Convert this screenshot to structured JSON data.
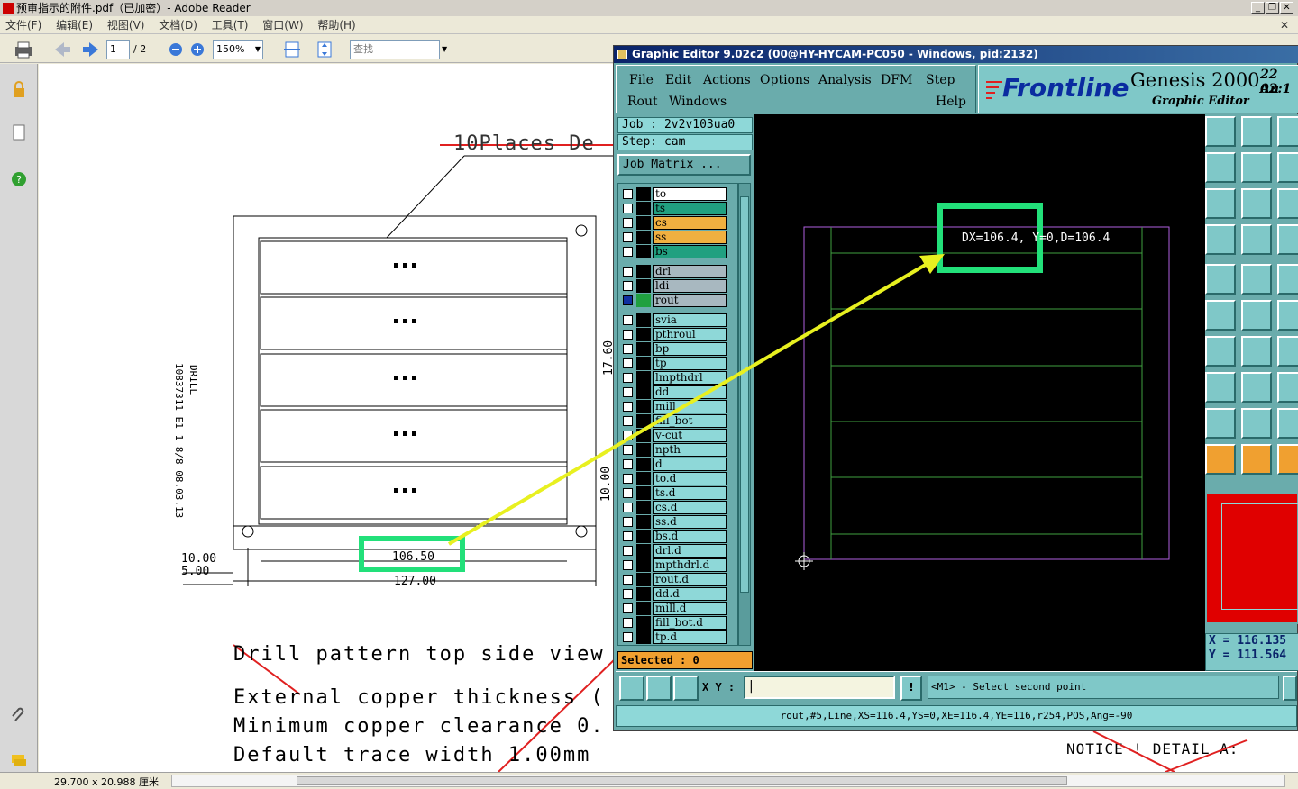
{
  "reader": {
    "title": "预审指示的附件.pdf（已加密）- Adobe Reader",
    "menu": [
      "文件(F)",
      "编辑(E)",
      "视图(V)",
      "文档(D)",
      "工具(T)",
      "窗口(W)",
      "帮助(H)"
    ],
    "page_current": "1",
    "page_total": "/ 2",
    "zoom": "150%",
    "find_placeholder": "查找",
    "status_size": "29.700 x 20.988 厘米"
  },
  "pdf": {
    "strike_title": "10Places De",
    "side_text": "10837311 E1 1    8/8 08.03.13",
    "side_text2": "DRILL",
    "dim_106": "106.50",
    "dim_127": "127.00",
    "dim_10": "10.00",
    "dim_5": "5.00",
    "dim_1760": "17.60",
    "dim_1000v": "10.00",
    "lines": [
      "Drill pattern top side view",
      "External copper thickness (",
      "Minimum copper clearance 0.",
      "Default trace width 1.00mm"
    ],
    "notice": "NOTICE ! DETAIL A:"
  },
  "genesis": {
    "title": "Graphic Editor 9.02c2 (00@HY-HYCAM-PC050 - Windows, pid:2132)",
    "menu_row1": [
      "File",
      "Edit",
      "Actions",
      "Options",
      "Analysis",
      "DFM",
      "Step"
    ],
    "menu_row2": [
      "Rout",
      "Windows",
      "Help"
    ],
    "logo": "Frontline",
    "product": "Genesis 2000",
    "subtitle": "Graphic Editor",
    "date1": "22 Au",
    "date2": "02:1",
    "job": "Job  : 2v2v103ua0",
    "step": "Step: cam",
    "job_matrix": "Job Matrix ...",
    "layers": [
      {
        "name": "to",
        "color": "#ffffff"
      },
      {
        "name": "ts",
        "color": "#20a080"
      },
      {
        "name": "cs",
        "color": "#f0b040"
      },
      {
        "name": "ss",
        "color": "#f0b040"
      },
      {
        "name": "bs",
        "color": "#20a080"
      },
      {
        "name": "drl",
        "color": "#a8b8c0"
      },
      {
        "name": "ldi",
        "color": "#a8b8c0"
      },
      {
        "name": "rout",
        "color": "#a8b8c0"
      },
      {
        "name": "svia",
        "color": "#8ed8d8"
      },
      {
        "name": "pthroul",
        "color": "#8ed8d8"
      },
      {
        "name": "bp",
        "color": "#8ed8d8"
      },
      {
        "name": "tp",
        "color": "#8ed8d8"
      },
      {
        "name": "lmpthdrl",
        "color": "#8ed8d8"
      },
      {
        "name": "dd",
        "color": "#8ed8d8"
      },
      {
        "name": "mill",
        "color": "#8ed8d8"
      },
      {
        "name": "fill_bot",
        "color": "#8ed8d8"
      },
      {
        "name": "v-cut",
        "color": "#8ed8d8"
      },
      {
        "name": "npth",
        "color": "#8ed8d8"
      },
      {
        "name": "d",
        "color": "#8ed8d8"
      },
      {
        "name": "to.d",
        "color": "#8ed8d8"
      },
      {
        "name": "ts.d",
        "color": "#8ed8d8"
      },
      {
        "name": "cs.d",
        "color": "#8ed8d8"
      },
      {
        "name": "ss.d",
        "color": "#8ed8d8"
      },
      {
        "name": "bs.d",
        "color": "#8ed8d8"
      },
      {
        "name": "drl.d",
        "color": "#8ed8d8"
      },
      {
        "name": "mpthdrl.d",
        "color": "#8ed8d8"
      },
      {
        "name": "rout.d",
        "color": "#8ed8d8"
      },
      {
        "name": "dd.d",
        "color": "#8ed8d8"
      },
      {
        "name": "mill.d",
        "color": "#8ed8d8"
      },
      {
        "name": "fill_bot.d",
        "color": "#8ed8d8"
      },
      {
        "name": "tp.d",
        "color": "#8ed8d8"
      }
    ],
    "selected": "Selected : 0",
    "measure": "DX=106.4, Y=0,D=106.4",
    "coord_x": "X = 116.135",
    "coord_y": "Y = 111.564",
    "xy_label": "X Y :",
    "prompt": "<M1> - Select second point",
    "status": "rout,#5,Line,XS=116.4,YS=0,XE=116.4,YE=116,r254,POS,Ang=-90"
  },
  "colors": {
    "highlight": "#22e07a",
    "arrow": "#e8f020",
    "board_outline": "#b060e0",
    "board_lines": "#40a040"
  }
}
